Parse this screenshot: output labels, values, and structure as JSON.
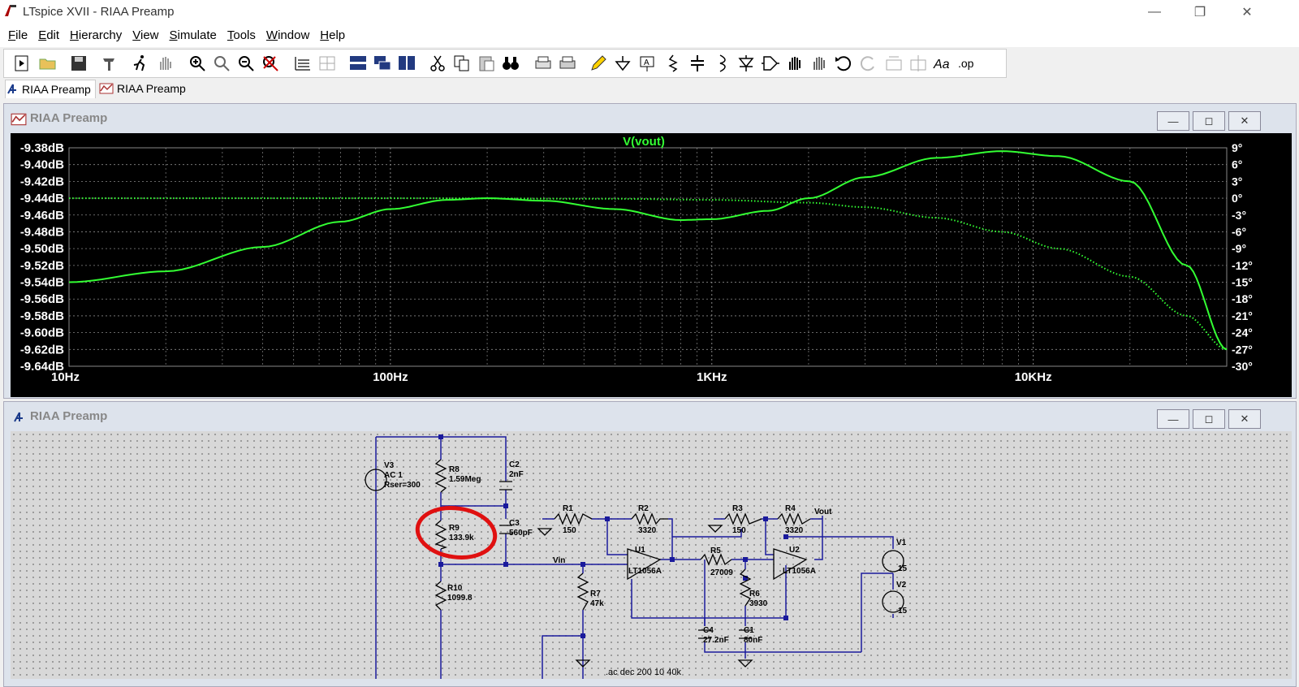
{
  "window": {
    "title": "LTspice XVII - RIAA Preamp"
  },
  "menu": [
    {
      "label": "File",
      "key": "F",
      "rest": "ile"
    },
    {
      "label": "Edit",
      "key": "E",
      "rest": "dit"
    },
    {
      "label": "Hierarchy",
      "key": "H",
      "rest": "ierarchy"
    },
    {
      "label": "View",
      "key": "V",
      "rest": "iew"
    },
    {
      "label": "Simulate",
      "key": "S",
      "rest": "imulate"
    },
    {
      "label": "Tools",
      "key": "T",
      "rest": "ools"
    },
    {
      "label": "Window",
      "key": "W",
      "rest": "indow"
    },
    {
      "label": "Help",
      "key": "H",
      "rest": "elp"
    }
  ],
  "tabs": [
    {
      "label": "RIAA Preamp",
      "icon": "schematic-icon"
    },
    {
      "label": "RIAA Preamp",
      "icon": "waveform-icon"
    }
  ],
  "plot_window": {
    "title": "RIAA Preamp",
    "trace_label": "V(vout)",
    "colors": {
      "background": "#000000",
      "trace": "#33ff33",
      "grid": "#888888",
      "text": "#ffffff"
    }
  },
  "schematic_window": {
    "title": "RIAA Preamp"
  },
  "chart_data": {
    "type": "line",
    "title": "V(vout)",
    "x_scale": "log",
    "xlim": [
      10,
      40000
    ],
    "x_ticks": [
      {
        "v": 10,
        "label": "10Hz"
      },
      {
        "v": 100,
        "label": "100Hz"
      },
      {
        "v": 1000,
        "label": "1KHz"
      },
      {
        "v": 10000,
        "label": "10KHz"
      }
    ],
    "ylim": [
      -9.64,
      -9.38
    ],
    "y_ticks": [
      "-9.38dB",
      "-9.40dB",
      "-9.42dB",
      "-9.44dB",
      "-9.46dB",
      "-9.48dB",
      "-9.50dB",
      "-9.52dB",
      "-9.54dB",
      "-9.56dB",
      "-9.58dB",
      "-9.60dB",
      "-9.62dB",
      "-9.64dB"
    ],
    "y2lim": [
      -30,
      9
    ],
    "y2_ticks": [
      "9°",
      "6°",
      "3°",
      "0°",
      "-3°",
      "-6°",
      "-9°",
      "-12°",
      "-15°",
      "-18°",
      "-21°",
      "-24°",
      "-27°",
      "-30°"
    ],
    "series": [
      {
        "style": "solid",
        "axis": "left",
        "x": [
          10,
          20,
          40,
          70,
          100,
          150,
          200,
          300,
          500,
          800,
          1000,
          1500,
          2000,
          3000,
          5000,
          8000,
          12000,
          20000,
          30000,
          40000
        ],
        "values": [
          -9.54,
          -9.527,
          -9.498,
          -9.468,
          -9.453,
          -9.442,
          -9.44,
          -9.443,
          -9.453,
          -9.466,
          -9.465,
          -9.455,
          -9.44,
          -9.415,
          -9.392,
          -9.384,
          -9.39,
          -9.42,
          -9.52,
          -9.62
        ]
      },
      {
        "style": "dotted",
        "axis": "right",
        "x": [
          10,
          100,
          500,
          1000,
          2000,
          3000,
          5000,
          8000,
          12000,
          20000,
          30000,
          40000
        ],
        "values": [
          0,
          0,
          -0.1,
          -0.3,
          -0.8,
          -1.6,
          -3.5,
          -6,
          -9,
          -14,
          -21,
          -27
        ]
      }
    ]
  },
  "schematic": {
    "components": [
      {
        "name": "V3",
        "value": "AC 1",
        "extra": "Rser=300"
      },
      {
        "name": "R8",
        "value": "1.59Meg"
      },
      {
        "name": "C2",
        "value": "2nF"
      },
      {
        "name": "R9",
        "value": "133.9k"
      },
      {
        "name": "C3",
        "value": "560pF"
      },
      {
        "name": "R10",
        "value": "1099.8"
      },
      {
        "name": "R1",
        "value": "150"
      },
      {
        "name": "R2",
        "value": "3320"
      },
      {
        "name": "U1",
        "value": "LT1056A"
      },
      {
        "name": "R7",
        "value": "47k"
      },
      {
        "name": "R5",
        "value": "27009"
      },
      {
        "name": "R6",
        "value": "3930"
      },
      {
        "name": "C4",
        "value": "27.2nF"
      },
      {
        "name": "C1",
        "value": "80nF"
      },
      {
        "name": "R3",
        "value": "150"
      },
      {
        "name": "R4",
        "value": "3320"
      },
      {
        "name": "U2",
        "value": "LT1056A"
      },
      {
        "name": "V1",
        "value": "15"
      },
      {
        "name": "V2",
        "value": "15"
      }
    ],
    "net_labels": [
      "Vin",
      "Vout"
    ],
    "directive": ".ac dec 200 10 40k"
  }
}
